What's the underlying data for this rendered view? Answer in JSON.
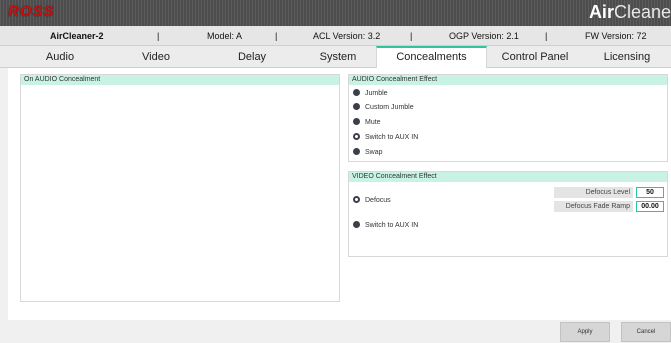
{
  "brand": {
    "ross_logo": "ROSS",
    "product_bold": "Air",
    "product_light": "Cleaner"
  },
  "info": {
    "device_name": "AirCleaner-2",
    "sep": "|",
    "model": "Model: A",
    "acl_version": "ACL Version: 3.2",
    "ogp_version": "OGP Version: 2.1",
    "fw_version": "FW Version: 72"
  },
  "tabs": [
    {
      "label": "Audio"
    },
    {
      "label": "Video"
    },
    {
      "label": "Delay"
    },
    {
      "label": "System"
    },
    {
      "label": "Concealments"
    },
    {
      "label": "Control Panel"
    },
    {
      "label": "Licensing"
    }
  ],
  "left_panel": {
    "title": "On AUDIO Concealment"
  },
  "audio_effect": {
    "title": "AUDIO Concealment Effect",
    "options": [
      {
        "label": "Jumble"
      },
      {
        "label": "Custom Jumble"
      },
      {
        "label": "Mute"
      },
      {
        "label": "Switch to AUX IN"
      },
      {
        "label": "Swap"
      }
    ],
    "selected": "Switch to AUX IN"
  },
  "video_effect": {
    "title": "VIDEO Concealment Effect",
    "options": [
      {
        "label": "Defocus"
      },
      {
        "label": "Switch to AUX IN"
      }
    ],
    "selected": "Defocus",
    "defocus_level_label": "Defocus Level",
    "defocus_level_value": "50",
    "defocus_fade_label": "Defocus Fade Ramp",
    "defocus_fade_value": "00.00"
  },
  "footer": {
    "apply_label": "Apply",
    "cancel_label": "Cancel"
  },
  "colors": {
    "accent": "#2ec4a0",
    "panel_header": "#c8f2e4",
    "brand_red": "#d01010"
  }
}
